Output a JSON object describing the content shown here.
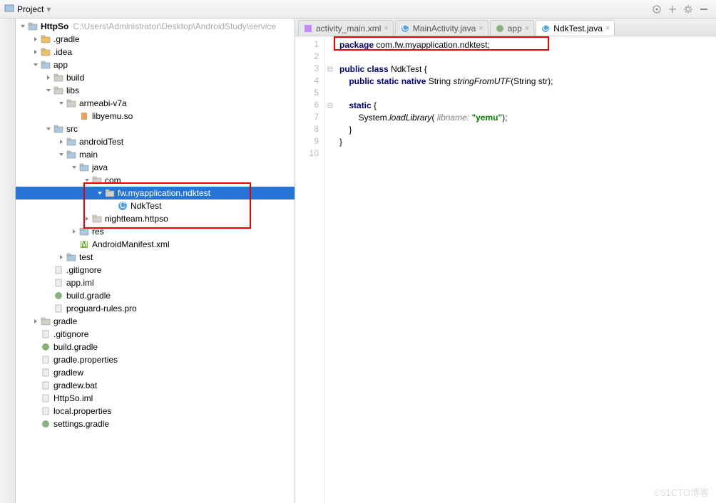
{
  "toolbar": {
    "title": "Project",
    "dropdown": "▾"
  },
  "tabs": [
    {
      "label": "activity_main.xml",
      "icon": "xml"
    },
    {
      "label": "MainActivity.java",
      "icon": "class"
    },
    {
      "label": "app",
      "icon": "gradle"
    },
    {
      "label": "NdkTest.java",
      "icon": "class",
      "active": true
    }
  ],
  "tree": {
    "root": {
      "name": "HttpSo",
      "path": "C:\\Users\\Administrator\\Desktop\\AndroidStudy\\service"
    },
    "items": [
      {
        "d": 1,
        "ar": "r",
        "ic": "fld-y",
        "t": ".gradle"
      },
      {
        "d": 1,
        "ar": "r",
        "ic": "fld-y",
        "t": ".idea"
      },
      {
        "d": 1,
        "ar": "d",
        "ic": "fld-b",
        "t": "app"
      },
      {
        "d": 2,
        "ar": "r",
        "ic": "fld-g",
        "t": "build"
      },
      {
        "d": 2,
        "ar": "d",
        "ic": "fld-g",
        "t": "libs"
      },
      {
        "d": 3,
        "ar": "d",
        "ic": "fld-g",
        "t": "armeabi-v7a"
      },
      {
        "d": 4,
        "ar": "",
        "ic": "file-so",
        "t": "libyemu.so"
      },
      {
        "d": 2,
        "ar": "d",
        "ic": "fld-b",
        "t": "src"
      },
      {
        "d": 3,
        "ar": "r",
        "ic": "fld-b",
        "t": "androidTest"
      },
      {
        "d": 3,
        "ar": "d",
        "ic": "fld-b",
        "t": "main"
      },
      {
        "d": 4,
        "ar": "d",
        "ic": "fld-b",
        "t": "java"
      },
      {
        "d": 5,
        "ar": "d",
        "ic": "fld-g",
        "t": "com"
      },
      {
        "d": 6,
        "ar": "d",
        "ic": "fld-g",
        "t": "fw.myapplication.ndktest",
        "sel": true
      },
      {
        "d": 7,
        "ar": "",
        "ic": "file-c",
        "t": "NdkTest"
      },
      {
        "d": 5,
        "ar": "r",
        "ic": "fld-g",
        "t": "nightteam.httpso"
      },
      {
        "d": 4,
        "ar": "r",
        "ic": "fld-b",
        "t": "res"
      },
      {
        "d": 4,
        "ar": "",
        "ic": "file-mf",
        "t": "AndroidManifest.xml"
      },
      {
        "d": 3,
        "ar": "r",
        "ic": "fld-b",
        "t": "test"
      },
      {
        "d": 2,
        "ar": "",
        "ic": "file-g",
        "t": ".gitignore"
      },
      {
        "d": 2,
        "ar": "",
        "ic": "file-g",
        "t": "app.iml"
      },
      {
        "d": 2,
        "ar": "",
        "ic": "file-gr",
        "t": "build.gradle"
      },
      {
        "d": 2,
        "ar": "",
        "ic": "file-g",
        "t": "proguard-rules.pro"
      },
      {
        "d": 1,
        "ar": "r",
        "ic": "fld-g",
        "t": "gradle"
      },
      {
        "d": 1,
        "ar": "",
        "ic": "file-g",
        "t": ".gitignore"
      },
      {
        "d": 1,
        "ar": "",
        "ic": "file-gr",
        "t": "build.gradle"
      },
      {
        "d": 1,
        "ar": "",
        "ic": "file-g",
        "t": "gradle.properties"
      },
      {
        "d": 1,
        "ar": "",
        "ic": "file-g",
        "t": "gradlew"
      },
      {
        "d": 1,
        "ar": "",
        "ic": "file-g",
        "t": "gradlew.bat"
      },
      {
        "d": 1,
        "ar": "",
        "ic": "file-g",
        "t": "HttpSo.iml"
      },
      {
        "d": 1,
        "ar": "",
        "ic": "file-g",
        "t": "local.properties"
      },
      {
        "d": 1,
        "ar": "",
        "ic": "file-gr",
        "t": "settings.gradle"
      }
    ]
  },
  "code": {
    "lines": [
      {
        "n": 1,
        "html": "<span class=\"kw\">package</span> com.fw.myapplication.ndktest;"
      },
      {
        "n": 2,
        "html": ""
      },
      {
        "n": 3,
        "html": "<span class=\"kw\">public class</span> NdkTest {"
      },
      {
        "n": 4,
        "html": "    <span class=\"kw\">public static native</span> String <span class=\"fn\">stringFromUTF</span>(String str);"
      },
      {
        "n": 5,
        "html": ""
      },
      {
        "n": 6,
        "html": "    <span class=\"kw\">static</span> {"
      },
      {
        "n": 7,
        "html": "        System.<span class=\"fn\">loadLibrary</span>( <span class=\"cmt\">libname:</span> <span class=\"str\">\"yemu\"</span>);"
      },
      {
        "n": 8,
        "html": "    }"
      },
      {
        "n": 9,
        "html": "}"
      },
      {
        "n": 10,
        "html": ""
      }
    ],
    "caretLine": 10
  },
  "watermark": "©51CTO博客"
}
